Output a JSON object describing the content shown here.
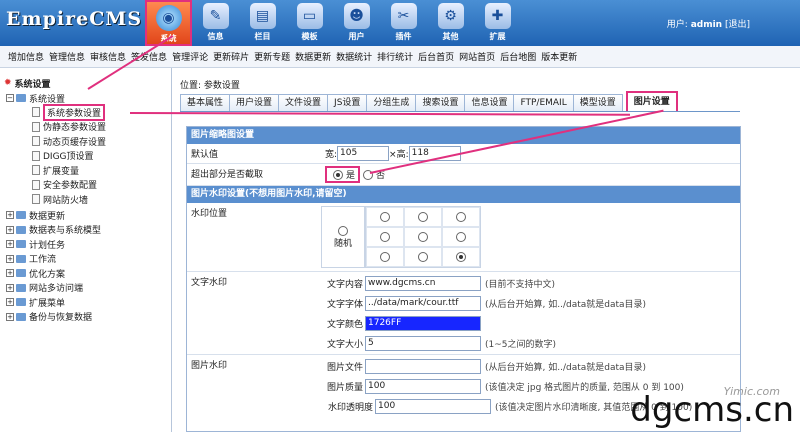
{
  "logo": "EmpireCMS",
  "nav": [
    {
      "label": "系统",
      "icon": "globe-icon",
      "glyph": "◉"
    },
    {
      "label": "信息",
      "icon": "pencil-icon",
      "glyph": "✎"
    },
    {
      "label": "栏目",
      "icon": "folder-icon",
      "glyph": "▤"
    },
    {
      "label": "模板",
      "icon": "window-icon",
      "glyph": "▭"
    },
    {
      "label": "用户",
      "icon": "user-icon",
      "glyph": "☻"
    },
    {
      "label": "插件",
      "icon": "tools-icon",
      "glyph": "✂"
    },
    {
      "label": "其他",
      "icon": "gear-icon",
      "glyph": "⚙"
    },
    {
      "label": "扩展",
      "icon": "plus-icon",
      "glyph": "✚"
    }
  ],
  "user": {
    "prefix": "用户:",
    "name": "admin",
    "logout": "[退出]"
  },
  "menubar": [
    "增加信息",
    "管理信息",
    "审核信息",
    "签发信息",
    "管理评论",
    "更新碎片",
    "更新专题",
    "数据更新",
    "数据统计",
    "排行统计",
    "后台首页",
    "网站首页",
    "后台地图",
    "版本更新"
  ],
  "tree": {
    "root": "系统设置",
    "sys": "系统设置",
    "sys_items": [
      "系统参数设置",
      "伪静态参数设置",
      "动态页缓存设置",
      "DIGG顶设置",
      "扩展变量",
      "安全参数配置",
      "网站防火墙"
    ],
    "groups": [
      "数据更新",
      "数据表与系统模型",
      "计划任务",
      "工作流",
      "优化方案",
      "网站多访问端",
      "扩展菜单",
      "备份与恢复数据"
    ]
  },
  "location": "位置: 参数设置",
  "tabs": [
    "基本属性",
    "用户设置",
    "文件设置",
    "JS设置",
    "分组生成",
    "搜索设置",
    "信息设置",
    "FTP/EMAIL",
    "模型设置",
    "图片设置"
  ],
  "thumb": {
    "section": "图片缩略图设置",
    "default_label": "默认值",
    "width_label": "宽:",
    "width": "105",
    "height_label": "×高:",
    "height": "118",
    "crop_label": "超出部分是否截取",
    "yes": "是",
    "no": "否"
  },
  "wm": {
    "section": "图片水印设置(不想用图片水印,请留空)",
    "pos_label": "水印位置",
    "random": "随机",
    "text_label": "文字水印",
    "content_k": "文字内容",
    "content_v": "www.dgcms.cn",
    "content_h": "(目前不支持中文)",
    "font_k": "文字字体",
    "font_v": "../data/mark/cour.ttf",
    "font_h": "(从后台开始算, 如../data就是data目录)",
    "color_k": "文字颜色",
    "color_v": "1726FF",
    "size_k": "文字大小",
    "size_v": "5",
    "size_h": "(1~5之间的数字)",
    "img_label": "图片水印",
    "file_k": "图片文件",
    "file_v": "",
    "file_h": "(从后台开始算, 如../data就是data目录)",
    "q_k": "图片质量",
    "q_v": "100",
    "q_h": "(该值决定 jpg 格式图片的质量, 范围从 0 到 100)",
    "alpha_k": "水印透明度",
    "alpha_v": "100",
    "alpha_h": "(该值决定图片水印清晰度, 其值范围从 0 到 100)"
  },
  "watermark": "dgcms.cn",
  "watermark2": "Yimic.com",
  "colors": {
    "accent": "#e0307e",
    "header": "#1f63b3",
    "wm_color": "#1726FF"
  }
}
